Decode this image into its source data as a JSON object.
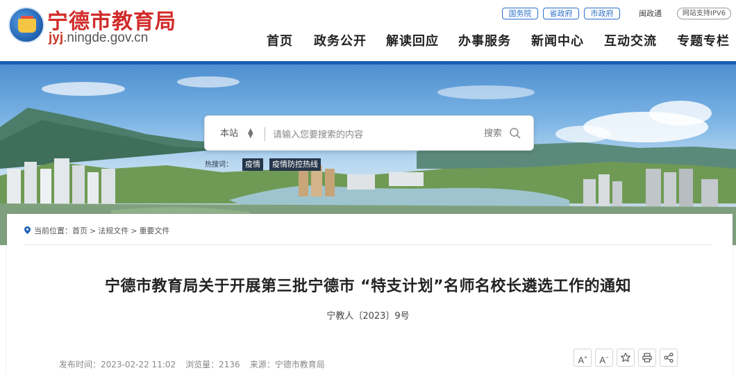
{
  "header": {
    "site_title": "宁德市教育局",
    "domain_prefix": "jyj",
    "domain_rest": ".ningde.gov.cn",
    "top_links": [
      {
        "label": "国务院",
        "style": "pill"
      },
      {
        "label": "省政府",
        "style": "pill"
      },
      {
        "label": "市政府",
        "style": "pill"
      },
      {
        "label": "闽政通",
        "style": "plain"
      },
      {
        "label": "网站支持IPV6",
        "style": "outline"
      }
    ],
    "nav": [
      "首页",
      "政务公开",
      "解读回应",
      "办事服务",
      "新闻中心",
      "互动交流",
      "专题专栏"
    ]
  },
  "search": {
    "scope": "本站",
    "placeholder": "请输入您要搜索的内容",
    "button_label": "搜索",
    "hot_label": "热搜词：",
    "hot_words": [
      "疫情",
      "疫情防控热线"
    ]
  },
  "breadcrumb": {
    "prefix": "当前位置：",
    "items": [
      "首页",
      "法规文件",
      "重要文件"
    ],
    "separator": ">"
  },
  "article": {
    "title": "宁德市教育局关于开展第三批宁德市 “特支计划”名师名校长遴选工作的通知",
    "doc_number": "宁教人〔2023〕9号",
    "publish_time": "发布时间：2023-02-22 11:02",
    "views": "浏览量：2136",
    "source": "来源：宁德市教育局"
  },
  "tools": {
    "font_increase": "A",
    "font_decrease": "A",
    "font_increase_mark": "+",
    "font_decrease_mark": "−"
  },
  "colors": {
    "brand_blue": "#1a5fb4",
    "title_red": "#d22b2b",
    "pill_blue": "#2a6fc9"
  }
}
